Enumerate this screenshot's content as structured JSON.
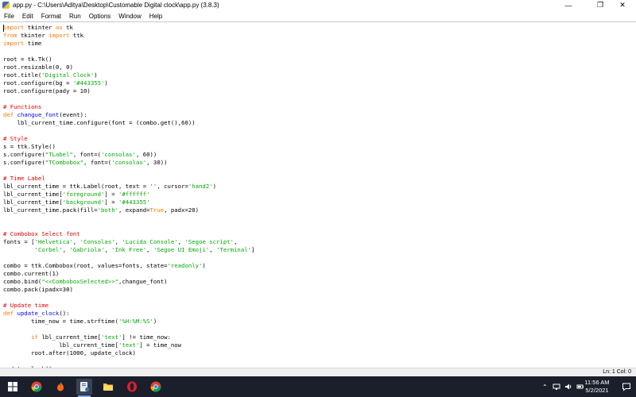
{
  "window": {
    "title": "app.py - C:\\Users\\Aditya\\Desktop\\Customable Digital clock\\app.py (3.8.3)",
    "minimize": "—",
    "maximize": "❐",
    "close": "✕"
  },
  "menu": [
    "File",
    "Edit",
    "Format",
    "Run",
    "Options",
    "Window",
    "Help"
  ],
  "code_lines": [
    [
      [
        "kw",
        "import"
      ],
      [
        "n",
        " tkinter "
      ],
      [
        "kw",
        "as"
      ],
      [
        "n",
        " tk"
      ]
    ],
    [
      [
        "kw",
        "from"
      ],
      [
        "n",
        " tkinter "
      ],
      [
        "kw",
        "import"
      ],
      [
        "n",
        " ttk"
      ]
    ],
    [
      [
        "kw",
        "import"
      ],
      [
        "n",
        " time"
      ]
    ],
    [],
    [
      [
        "n",
        "root = tk.Tk()"
      ]
    ],
    [
      [
        "n",
        "root.resizable(0, 0)"
      ]
    ],
    [
      [
        "n",
        "root.title("
      ],
      [
        "str",
        "'Digital Clock'"
      ],
      [
        "n",
        ")"
      ]
    ],
    [
      [
        "n",
        "root.configure(bg = "
      ],
      [
        "str",
        "'#443355'"
      ],
      [
        "n",
        ")"
      ]
    ],
    [
      [
        "n",
        "root.configure(pady = 10)"
      ]
    ],
    [],
    [
      [
        "cmt",
        "# Functions"
      ]
    ],
    [
      [
        "kw",
        "def"
      ],
      [
        "n",
        " "
      ],
      [
        "fn",
        "changue_font"
      ],
      [
        "n",
        "(event):"
      ]
    ],
    [
      [
        "n",
        "    lbl_current_time.configure(font = (combo.get(),60))"
      ]
    ],
    [],
    [
      [
        "cmt",
        "# Style"
      ]
    ],
    [
      [
        "n",
        "s = ttk.Style()"
      ]
    ],
    [
      [
        "n",
        "s.configure("
      ],
      [
        "str",
        "\"TLabel\""
      ],
      [
        "n",
        ", font=("
      ],
      [
        "str",
        "'consolas'"
      ],
      [
        "n",
        ", 60))"
      ]
    ],
    [
      [
        "n",
        "s.configure("
      ],
      [
        "str",
        "\"TCombobox\""
      ],
      [
        "n",
        ", font=("
      ],
      [
        "str",
        "'consolas'"
      ],
      [
        "n",
        ", 30))"
      ]
    ],
    [],
    [
      [
        "cmt",
        "# Time Label"
      ]
    ],
    [
      [
        "n",
        "lbl_current_time = ttk.Label(root, text = "
      ],
      [
        "str",
        "''"
      ],
      [
        "n",
        ", cursor="
      ],
      [
        "str",
        "'hand2'"
      ],
      [
        "n",
        ")"
      ]
    ],
    [
      [
        "n",
        "lbl_current_time["
      ],
      [
        "str",
        "'foreground'"
      ],
      [
        "n",
        "] = "
      ],
      [
        "str",
        "'#ffffff'"
      ]
    ],
    [
      [
        "n",
        "lbl_current_time["
      ],
      [
        "str",
        "'background'"
      ],
      [
        "n",
        "] = "
      ],
      [
        "str",
        "'#443355'"
      ]
    ],
    [
      [
        "n",
        "lbl_current_time.pack(fill="
      ],
      [
        "str",
        "'both'"
      ],
      [
        "n",
        ", expand="
      ],
      [
        "kw",
        "True"
      ],
      [
        "n",
        ", padx=20)"
      ]
    ],
    [],
    [],
    [
      [
        "cmt",
        "# Combobox Select font"
      ]
    ],
    [
      [
        "n",
        "fonts = ["
      ],
      [
        "str",
        "'Helvetica'"
      ],
      [
        "n",
        ", "
      ],
      [
        "str",
        "'Consolas'"
      ],
      [
        "n",
        ", "
      ],
      [
        "str",
        "'Lucida Console'"
      ],
      [
        "n",
        ", "
      ],
      [
        "str",
        "'Segoe script'"
      ],
      [
        "n",
        ","
      ]
    ],
    [
      [
        "n",
        "         "
      ],
      [
        "str",
        "'Corbel'"
      ],
      [
        "n",
        ", "
      ],
      [
        "str",
        "'Gabriola'"
      ],
      [
        "n",
        ", "
      ],
      [
        "str",
        "'Ink Free'"
      ],
      [
        "n",
        ", "
      ],
      [
        "str",
        "'Segoe UI Emoji'"
      ],
      [
        "n",
        ", "
      ],
      [
        "str",
        "'Terminal'"
      ],
      [
        "n",
        "]"
      ]
    ],
    [],
    [
      [
        "n",
        "combo = ttk.Combobox(root, values=fonts, state="
      ],
      [
        "str",
        "'readonly'"
      ],
      [
        "n",
        ")"
      ]
    ],
    [
      [
        "n",
        "combo.current(1)"
      ]
    ],
    [
      [
        "n",
        "combo.bind("
      ],
      [
        "str",
        "\"<<ComboboxSelected>>\""
      ],
      [
        "n",
        ",changue_font)"
      ]
    ],
    [
      [
        "n",
        "combo.pack(ipadx=30)"
      ]
    ],
    [],
    [
      [
        "cmt",
        "# Update time"
      ]
    ],
    [
      [
        "kw",
        "def"
      ],
      [
        "n",
        " "
      ],
      [
        "fn",
        "update_clock"
      ],
      [
        "n",
        "():"
      ]
    ],
    [
      [
        "n",
        "        time_now = time.strftime("
      ],
      [
        "str",
        "'%H:%M:%S'"
      ],
      [
        "n",
        ")"
      ]
    ],
    [],
    [
      [
        "n",
        "        "
      ],
      [
        "kw",
        "if"
      ],
      [
        "n",
        " lbl_current_time["
      ],
      [
        "str",
        "'text'"
      ],
      [
        "n",
        "] != time_now:"
      ]
    ],
    [
      [
        "n",
        "                lbl_current_time["
      ],
      [
        "str",
        "'text'"
      ],
      [
        "n",
        "] = time_now"
      ]
    ],
    [
      [
        "n",
        "        root.after(1000, update_clock)"
      ]
    ],
    [],
    [
      [
        "n",
        "update_clock()"
      ]
    ]
  ],
  "status": {
    "line_col": "Ln: 1   Col: 0"
  },
  "taskbar": {
    "clock_time": "11:56 AM",
    "clock_date": "5/2/2021",
    "icons": [
      "windows-start-icon",
      "chrome-icon",
      "fire-app-icon",
      "idle-python-icon",
      "file-explorer-icon",
      "opera-icon",
      "chrome-icon"
    ]
  },
  "colors": {
    "keyword": "#ff7700",
    "string": "#00aa00",
    "comment": "#dd0000",
    "definition": "#0000ff",
    "taskbar": "#1a1f2b"
  }
}
